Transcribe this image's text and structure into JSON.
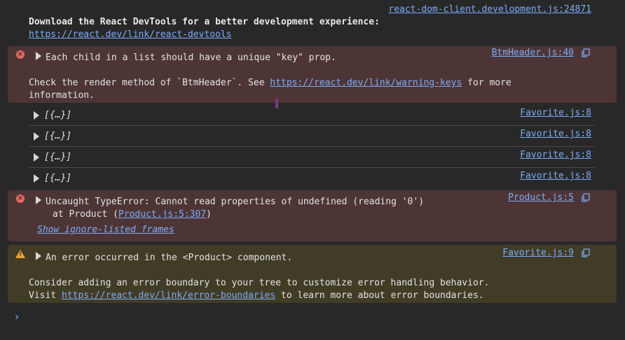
{
  "info": {
    "source": "react-dom-client.development.js:24871",
    "message": "Download the React DevTools for a better development experience:",
    "link": "https://react.dev/link/react-devtools"
  },
  "error1": {
    "badge": "×",
    "source": "BtmHeader.js:40",
    "message": "Each child in a list should have a unique \"key\" prop.",
    "detail_prefix": "Check the render method of `BtmHeader`. See ",
    "detail_link": "https://react.dev/link/warning-keys",
    "detail_suffix": " for more",
    "detail_line2": "information."
  },
  "rows": [
    {
      "label": "[{…}]",
      "source": "Favorite.js:8"
    },
    {
      "label": "[{…}]",
      "source": "Favorite.js:8"
    },
    {
      "label": "[{…}]",
      "source": "Favorite.js:8"
    },
    {
      "label": "[{…}]",
      "source": "Favorite.js:8"
    }
  ],
  "error2": {
    "badge": "×",
    "source": "Product.js:5",
    "message": "Uncaught TypeError: Cannot read properties of undefined (reading '0')",
    "stack_prefix": "at Product (",
    "stack_link": "Product.js:5:307",
    "stack_suffix": ")",
    "ignore_link": "Show ignore-listed frames"
  },
  "warning": {
    "badge": "!",
    "source": "Favorite.js:9",
    "message": "An error occurred in the <Product> component.",
    "line1": "Consider adding an error boundary to your tree to customize error handling behavior.",
    "line2_prefix": "Visit ",
    "line2_link": "https://react.dev/link/error-boundaries",
    "line2_suffix": " to learn more about error boundaries."
  },
  "prompt": "›",
  "colors": {
    "background": "#282828",
    "error_bg": "#4e3535",
    "warning_bg": "#413c26",
    "link": "#7cacf8",
    "error_icon": "#e46962",
    "warning_icon": "#f2a43c"
  }
}
